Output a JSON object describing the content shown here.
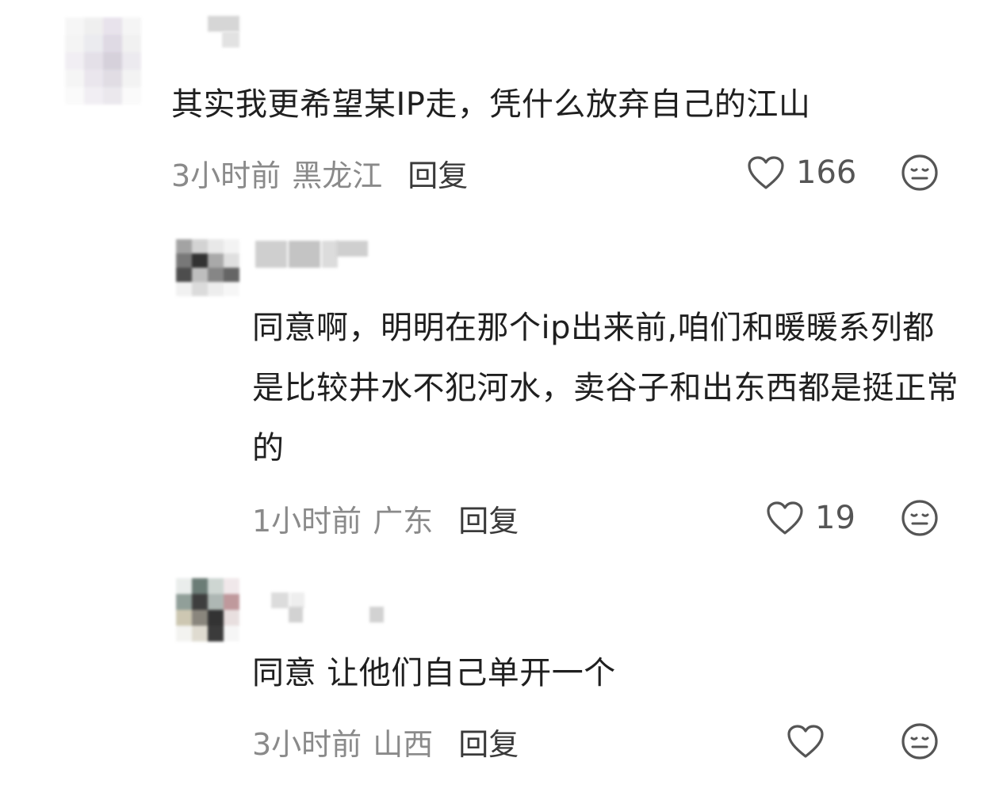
{
  "comments": [
    {
      "text": "其实我更希望某IP走，凭什么放弃自己的江山",
      "time": "3小时前",
      "region": "黑龙江",
      "reply_label": "回复",
      "likes": "166"
    },
    {
      "text": "同意啊，明明在那个ip出来前,咱们和暖暖系列都是比较井水不犯河水，卖谷子和出东西都是挺正常的",
      "time": "1小时前",
      "region": "广东",
      "reply_label": "回复",
      "likes": "19"
    },
    {
      "text": "同意 让他们自己单开一个",
      "time": "3小时前",
      "region": "山西",
      "reply_label": "回复",
      "likes": ""
    }
  ],
  "icons": {
    "like": "heart-outline-icon",
    "dislike": "neutral-face-icon"
  },
  "colors": {
    "text": "#1f1f1f",
    "meta": "#8a8a8a",
    "icon": "#555555"
  }
}
